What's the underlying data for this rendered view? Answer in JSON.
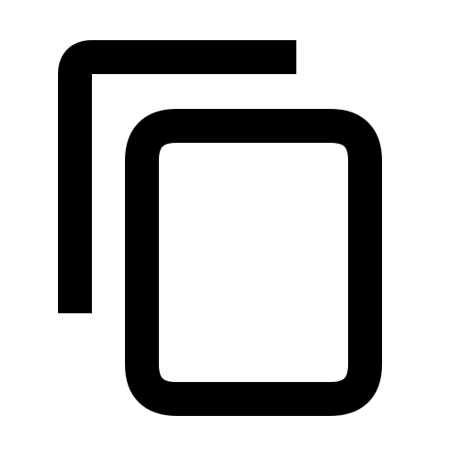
{
  "icon": {
    "name": "copy-icon",
    "stroke_color": "#000000",
    "background_color": "#ffffff"
  }
}
